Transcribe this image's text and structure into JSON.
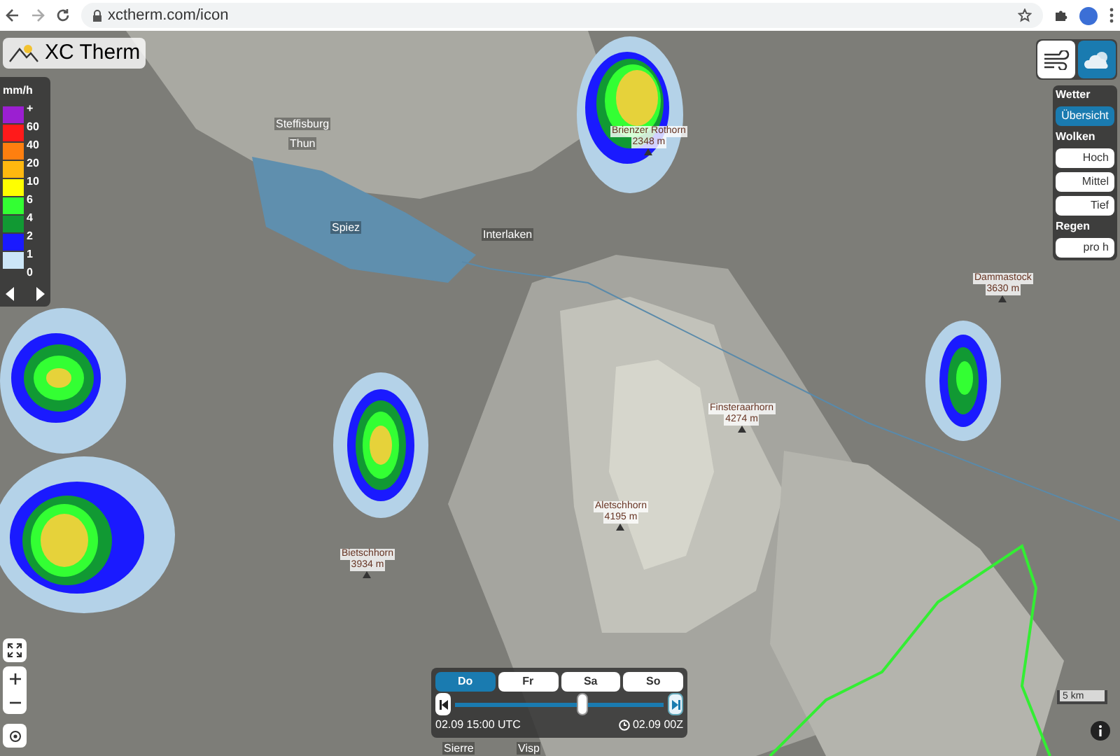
{
  "browser": {
    "url": "xctherm.com/icon"
  },
  "logo": {
    "text": "XC Therm"
  },
  "legend": {
    "unit": "mm/h",
    "labels": [
      "+",
      "60",
      "40",
      "20",
      "10",
      "6",
      "4",
      "2",
      "1",
      "0"
    ],
    "swatches": [
      {
        "color": "#9b1fd1"
      },
      {
        "color": "#ff1a1a"
      },
      {
        "color": "#ff7f0f"
      },
      {
        "color": "#ffb80f"
      },
      {
        "color": "#ffff00"
      },
      {
        "color": "#33ff33"
      },
      {
        "color": "#119933"
      },
      {
        "color": "#1a1aff"
      },
      {
        "color": "#cce6f7"
      }
    ]
  },
  "layer_tabs": [
    {
      "kind": "wind",
      "selected": false
    },
    {
      "kind": "weather",
      "selected": true
    }
  ],
  "layer_panel": [
    {
      "heading": "Wetter",
      "options": [
        {
          "label": "Übersicht",
          "selected": true
        }
      ]
    },
    {
      "heading": "Wolken",
      "options": [
        {
          "label": "Hoch",
          "selected": false
        },
        {
          "label": "Mittel",
          "selected": false
        },
        {
          "label": "Tief",
          "selected": false
        }
      ]
    },
    {
      "heading": "Regen",
      "options": [
        {
          "label": "pro h",
          "selected": false
        }
      ]
    }
  ],
  "map_labels": [
    {
      "name": "Steffisburg"
    },
    {
      "name": "Thun"
    },
    {
      "name": "Spiez"
    },
    {
      "name": "Interlaken"
    },
    {
      "name": "Brienzer Rothorn",
      "elevation": "2348 m"
    },
    {
      "name": "Dammastock",
      "elevation": "3630 m"
    },
    {
      "name": "Finsteraarhorn",
      "elevation": "4274 m"
    },
    {
      "name": "Aletschhorn",
      "elevation": "4195 m"
    },
    {
      "name": "Bietschhorn",
      "elevation": "3934 m"
    },
    {
      "name": "Sierre"
    },
    {
      "name": "Visp"
    }
  ],
  "scale": {
    "label": "5 km"
  },
  "timeline": {
    "days": [
      {
        "label": "Do",
        "selected": true
      },
      {
        "label": "Fr",
        "selected": false
      },
      {
        "label": "Sa",
        "selected": false
      },
      {
        "label": "So",
        "selected": false
      }
    ],
    "level": 0.61,
    "current_time": "02.09 15:00 UTC",
    "run_time": "02.09 00Z"
  }
}
